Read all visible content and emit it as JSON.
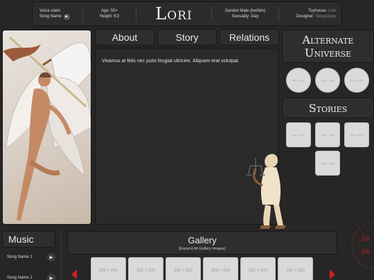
{
  "header": {
    "voice_claim_label": "Voice claim",
    "song_name": "Song Name",
    "age": "Age: 50+",
    "height": "Height: 6'2",
    "title": "Lori",
    "gender": "Gender:Male (he/him)",
    "sexuality": "Sexuality: Gay",
    "toyhouse_label": "Toyhouse:",
    "toyhouse_value": "Link",
    "designer_label": "Designer:",
    "designer_value": "Sleepcrazy"
  },
  "tabs": [
    "About",
    "Story",
    "Relations"
  ],
  "content": {
    "text": "Vivamus at felis nec justo feugiat ultricies. Aliquam erat volutpat."
  },
  "alternate_universe": {
    "title": "Alternate Universe",
    "placeholders": [
      "200 × 200",
      "200 × 200",
      "200 × 200"
    ]
  },
  "stories": {
    "title": "Stories",
    "placeholders": [
      "200 × 200",
      "200 × 200",
      "200 × 200",
      "200 × 200"
    ]
  },
  "music": {
    "title": "Music",
    "songs": [
      "Song Name 1",
      "Song Name 1"
    ]
  },
  "gallery": {
    "title": "Gallery",
    "expand_label": "[Expand All Gallery Images]",
    "placeholders": [
      "200 × 200",
      "200 × 200",
      "200 × 200",
      "200 × 200",
      "200 × 200",
      "200 × 200"
    ]
  },
  "colors": {
    "accent": "#d21d1d",
    "background": "#262626",
    "panel": "#2e2e2e"
  },
  "icons": {
    "play": "play-icon",
    "arrow_left": "arrow-left-icon",
    "arrow_right": "arrow-right-icon"
  }
}
